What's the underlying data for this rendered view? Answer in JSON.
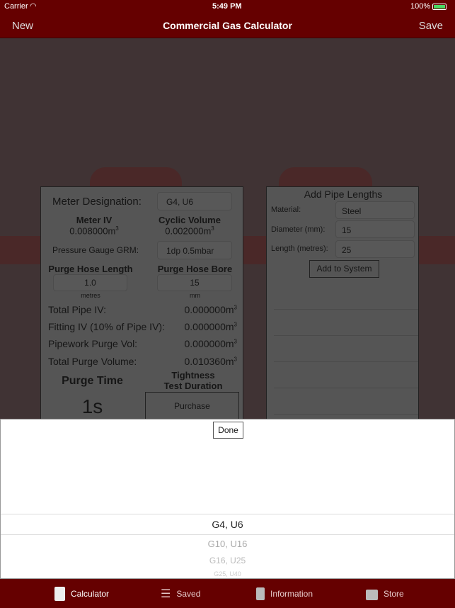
{
  "status": {
    "carrier": "Carrier",
    "time": "5:49 PM",
    "battery": "100%"
  },
  "nav": {
    "left": "New",
    "title": "Commercial Gas Calculator",
    "right": "Save"
  },
  "calc": {
    "meter_designation_label": "Meter Designation:",
    "meter_designation_value": "G4, U6",
    "meter_iv_label": "Meter IV",
    "meter_iv_value": "0.008000m",
    "cyclic_label": "Cyclic Volume",
    "cyclic_value": "0.002000m",
    "gauge_label": "Pressure Gauge GRM:",
    "gauge_value": "1dp 0.5mbar",
    "hose_length_label": "Purge Hose Length",
    "hose_length_value": "1.0",
    "hose_length_unit": "metres",
    "hose_bore_label": "Purge Hose Bore",
    "hose_bore_value": "15",
    "hose_bore_unit": "mm",
    "rows": [
      {
        "label": "Total Pipe IV:",
        "value": "0.000000m"
      },
      {
        "label": "Fitting IV (10% of Pipe IV):",
        "value": "0.000000m"
      },
      {
        "label": "Pipework Purge Vol:",
        "value": "0.000000m"
      },
      {
        "label": "Total Purge Volume:",
        "value": "0.010360m"
      }
    ],
    "cube": "3",
    "purge_time_label": "Purge Time",
    "purge_time_value": "1s",
    "tightness_label_1": "Tightness",
    "tightness_label_2": "Test Duration",
    "purchase": "Purchase"
  },
  "pipes": {
    "title": "Add Pipe Lengths",
    "material_label": "Material:",
    "material_value": "Steel",
    "diameter_label": "Diameter (mm):",
    "diameter_value": "15",
    "length_label": "Length (metres):",
    "length_value": "25",
    "add_button": "Add to System"
  },
  "picker": {
    "done": "Done",
    "options": [
      "G4, U6",
      "G10, U16",
      "G16, U25",
      "G25, U40"
    ],
    "selected": "G4, U6"
  },
  "tabs": [
    {
      "label": "Calculator",
      "icon": "calculator-icon"
    },
    {
      "label": "Saved",
      "icon": "list-icon"
    },
    {
      "label": "Information",
      "icon": "book-icon"
    },
    {
      "label": "Store",
      "icon": "bag-icon"
    }
  ],
  "colors": {
    "brand": "#650000",
    "battery": "#4cd964"
  }
}
